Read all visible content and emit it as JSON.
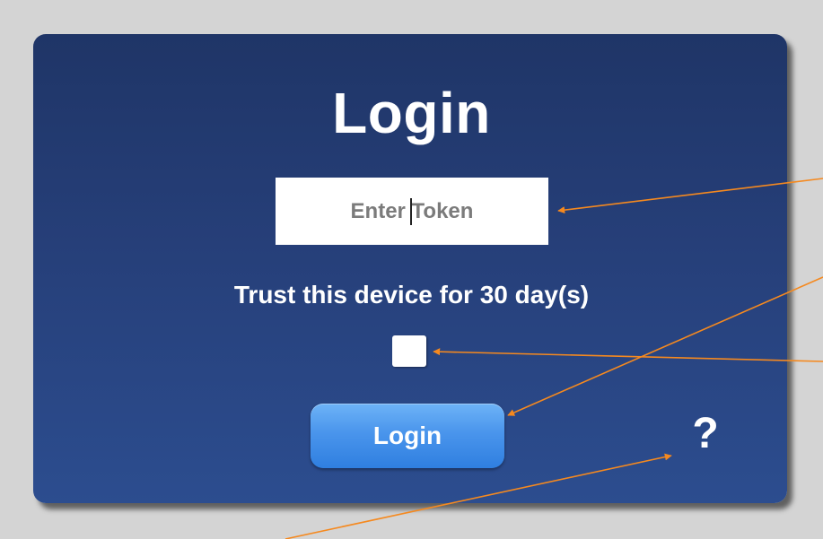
{
  "login_card": {
    "title": "Login",
    "token_input": {
      "placeholder": "Enter Token",
      "value": ""
    },
    "trust_device_label": "Trust this device for 30 day(s)",
    "trust_device_checked": false,
    "login_button_label": "Login",
    "help_label": "?"
  },
  "annotation": {
    "arrow_color": "#f5891f",
    "arrow_count": 4
  },
  "colors": {
    "page_background": "#d4d4d4",
    "card_top": "#1f3567",
    "card_bottom": "#2c4d8f",
    "button_top": "#6db3f7",
    "button_bottom": "#2f7fe0",
    "text": "#ffffff"
  }
}
